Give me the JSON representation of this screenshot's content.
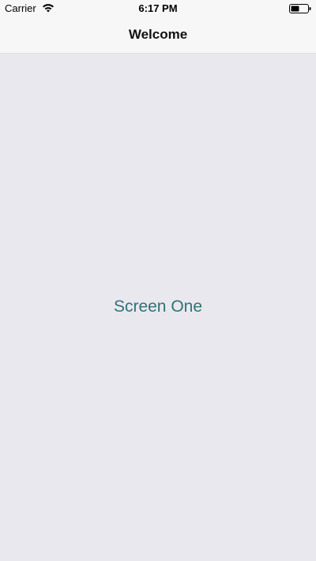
{
  "status_bar": {
    "carrier": "Carrier",
    "time": "6:17 PM",
    "wifi_icon": "wifi-icon",
    "battery_icon": "battery-icon"
  },
  "nav_bar": {
    "title": "Welcome"
  },
  "content": {
    "label": "Screen One",
    "label_color": "#2f7277",
    "background_color": "#e9e8ee"
  }
}
